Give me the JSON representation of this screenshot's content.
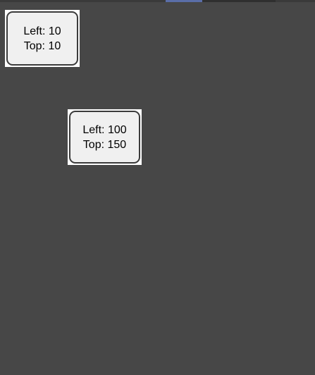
{
  "window": {
    "tabs": [
      {
        "label": ""
      },
      {
        "label": ""
      }
    ]
  },
  "boxes": [
    {
      "left_label": "Left: 10",
      "top_label": "Top: 10"
    },
    {
      "left_label": "Left: 100",
      "top_label": "Top: 150"
    }
  ],
  "colors": {
    "background": "#474747",
    "box_fill": "#f0f0f0",
    "box_border": "#3b3b3b",
    "box_frame": "#ffffff",
    "tab_active": "#5a6ea8"
  }
}
